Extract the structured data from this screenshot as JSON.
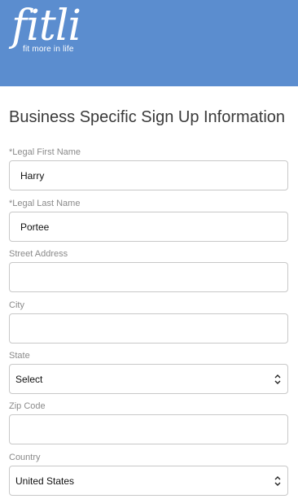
{
  "brand": {
    "logo_text": "fitli",
    "tagline": "fit more in life"
  },
  "header": {
    "bg": "#5b8dcf"
  },
  "page_title": "Business Specific Sign Up Information",
  "form": {
    "first_name": {
      "label": "*Legal First Name",
      "value": "Harry"
    },
    "last_name": {
      "label": "*Legal Last Name",
      "value": "Portee"
    },
    "street": {
      "label": "Street Address",
      "value": ""
    },
    "city": {
      "label": "City",
      "value": ""
    },
    "state": {
      "label": "State",
      "value": "Select"
    },
    "zip": {
      "label": "Zip Code",
      "value": ""
    },
    "country": {
      "label": "Country",
      "value": "United States"
    }
  }
}
